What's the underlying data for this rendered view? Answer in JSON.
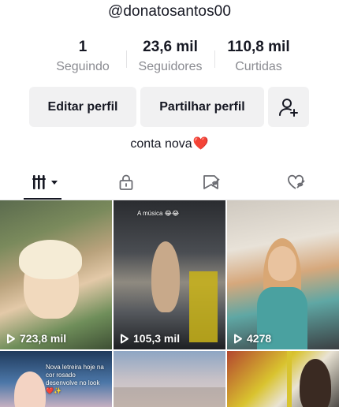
{
  "profile": {
    "username": "@donatosantos00",
    "bio_text": "conta nova",
    "bio_emoji": "❤️"
  },
  "stats": {
    "following": {
      "value": "1",
      "label": "Seguindo"
    },
    "followers": {
      "value": "23,6 mil",
      "label": "Seguidores"
    },
    "likes": {
      "value": "110,8 mil",
      "label": "Curtidas"
    }
  },
  "actions": {
    "edit_label": "Editar perfil",
    "share_label": "Partilhar perfil",
    "add_friend_icon": "add-user-icon"
  },
  "tabs": [
    {
      "icon": "videos-grid-icon",
      "active": true
    },
    {
      "icon": "lock-icon",
      "active": false
    },
    {
      "icon": "saved-hidden-icon",
      "active": false
    },
    {
      "icon": "liked-hidden-icon",
      "active": false
    }
  ],
  "videos": [
    {
      "views": "723,8 mil",
      "caption": ""
    },
    {
      "views": "105,3 mil",
      "caption": "A música 😂😂"
    },
    {
      "views": "4278",
      "caption": ""
    },
    {
      "views": "",
      "caption": "Nova letreira hoje na cor rosado desenvolve no look ❤️✨"
    },
    {
      "views": "",
      "caption": ""
    },
    {
      "views": "",
      "caption": ""
    }
  ],
  "colors": {
    "primary_text": "#161823",
    "secondary_text": "#8a8b91",
    "button_bg": "#f1f1f2",
    "heart": "#e8192c"
  }
}
